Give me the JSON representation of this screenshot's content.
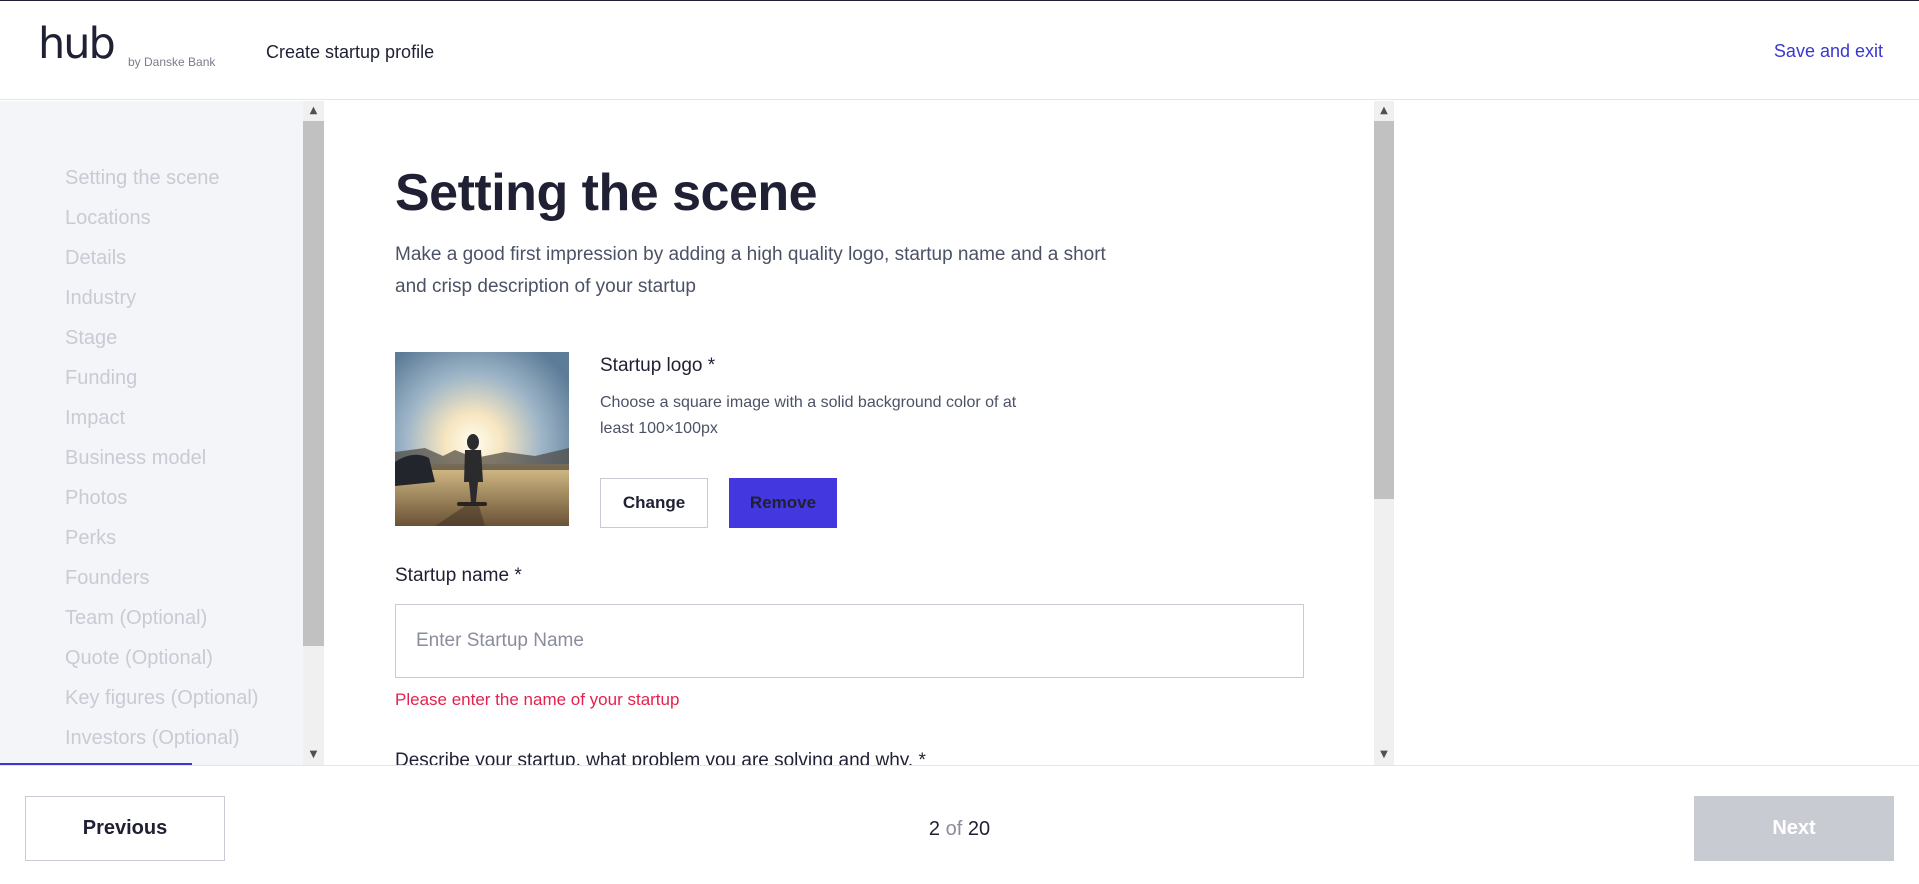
{
  "header": {
    "logo_text": "hub",
    "logo_sub": "by Danske Bank",
    "title": "Create startup profile",
    "save_exit": "Save and exit"
  },
  "sidebar": {
    "items": [
      {
        "label": "Setting the scene"
      },
      {
        "label": "Locations"
      },
      {
        "label": "Details"
      },
      {
        "label": "Industry"
      },
      {
        "label": "Stage"
      },
      {
        "label": "Funding"
      },
      {
        "label": "Impact"
      },
      {
        "label": "Business model"
      },
      {
        "label": "Photos"
      },
      {
        "label": "Perks"
      },
      {
        "label": "Founders"
      },
      {
        "label": "Team (Optional)"
      },
      {
        "label": "Quote (Optional)"
      },
      {
        "label": "Key figures (Optional)"
      },
      {
        "label": "Investors (Optional)"
      }
    ]
  },
  "main": {
    "title": "Setting the scene",
    "intro": "Make a good first impression by adding a high quality logo, startup name and a short and crisp description of your startup",
    "logo_section": {
      "title": "Startup logo *",
      "help": "Choose a square image with a solid background color of at least 100×100px",
      "change_label": "Change",
      "remove_label": "Remove"
    },
    "name_field": {
      "label": "Startup name *",
      "value": "",
      "placeholder": "Enter Startup Name",
      "error": "Please enter the name of your startup"
    },
    "describe_label": "Describe your startup, what problem you are solving and why. *"
  },
  "footer": {
    "previous_label": "Previous",
    "current_page": "2",
    "of_label": "of",
    "total_pages": "20",
    "next_label": "Next"
  },
  "colors": {
    "accent": "#3b36d0",
    "remove_button": "#4338e0",
    "error": "#e3224e",
    "next_disabled": "#c8cbd1",
    "sidebar_bg": "#f4f5f8"
  }
}
